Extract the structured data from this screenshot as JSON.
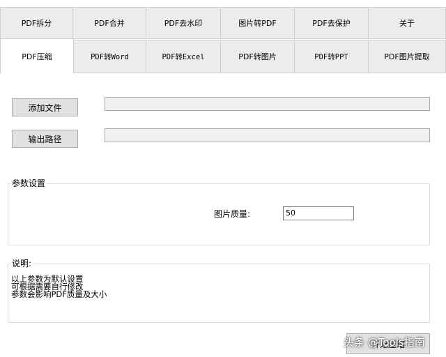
{
  "tabs": {
    "row1": [
      {
        "label": "PDF拆分"
      },
      {
        "label": "PDF合并"
      },
      {
        "label": "PDF去水印"
      },
      {
        "label": "图片转PDF"
      },
      {
        "label": "PDF去保护"
      },
      {
        "label": "关于"
      }
    ],
    "row2": [
      {
        "label": "PDF压缩",
        "selected": true
      },
      {
        "label": "PDF转Word"
      },
      {
        "label": "PDF转Excel"
      },
      {
        "label": "PDF转图片"
      },
      {
        "label": "PDF转PPT"
      },
      {
        "label": "PDF图片提取"
      }
    ]
  },
  "files": {
    "add_file_label": "添加文件",
    "add_file_value": "",
    "output_path_label": "输出路径",
    "output_path_value": ""
  },
  "params": {
    "title": "参数设置",
    "quality_label": "图片质量:",
    "quality_value": "50"
  },
  "notes": {
    "title": "说明:",
    "lines": [
      "以上参数为默认设置",
      "可根据需要自行修改",
      "参数会影响PDF质量及大小"
    ]
  },
  "footer": {
    "compress_button_label": "开始压缩"
  },
  "watermark": {
    "text": "头条 @Tools指南"
  },
  "colors": {
    "tab_background": "#ececec",
    "selected_tab_background": "#ffffff",
    "button_face": "#e1e1e1",
    "field_background": "#f0f0f0"
  }
}
